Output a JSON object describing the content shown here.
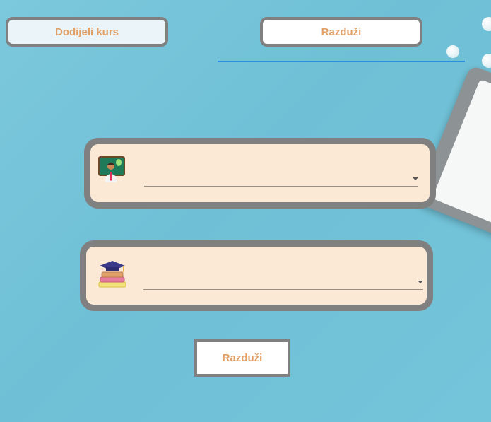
{
  "tabs": {
    "assign_label": "Dodijeli kurs",
    "return_label": "Razduži"
  },
  "teacher_select": {
    "value": ""
  },
  "course_select": {
    "value": ""
  },
  "submit": {
    "label": "Razduži"
  },
  "colors": {
    "background": "#74c4da",
    "card_fill": "#fbe9d6",
    "card_border": "#808080",
    "button_text": "#e0a067",
    "tab_underline": "#2f8ee0",
    "inactive_tab_fill": "#eaf4f9"
  },
  "icons": {
    "teacher": "teacher-at-blackboard-icon",
    "course": "graduation-cap-books-icon",
    "dropdown": "chevron-down-icon"
  }
}
